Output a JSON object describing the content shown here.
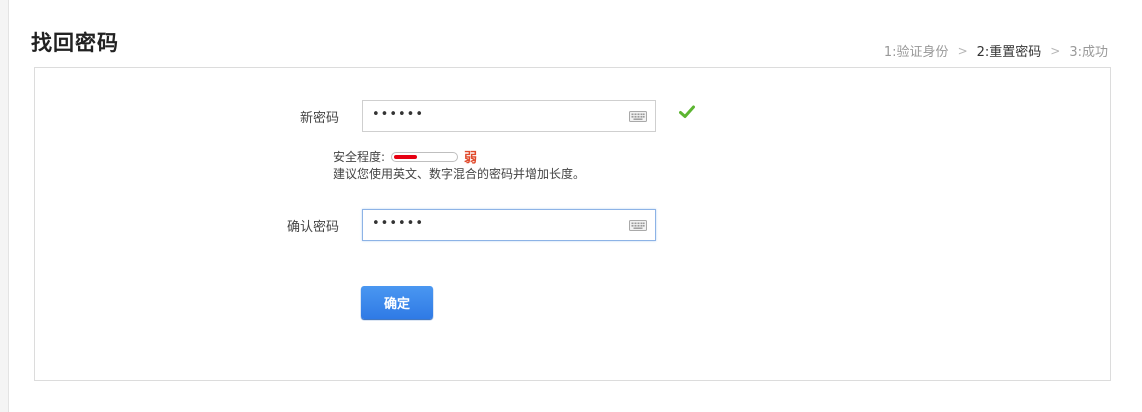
{
  "page": {
    "title": "找回密码"
  },
  "steps": [
    {
      "label": "1:验证身份",
      "active": false
    },
    {
      "label": "2:重置密码",
      "active": true
    },
    {
      "label": "3:成功",
      "active": false
    }
  ],
  "step_separator": ">",
  "form": {
    "new_password": {
      "label": "新密码",
      "value": "••••••",
      "status_icon": "check-icon"
    },
    "strength": {
      "label": "安全程度:",
      "level": "弱",
      "level_fraction": 0.35,
      "level_color": "#e04a2c"
    },
    "hint": "建议您使用英文、数字混合的密码并增加长度。",
    "confirm_password": {
      "label": "确认密码",
      "value": "••••••"
    },
    "submit_label": "确定"
  },
  "colors": {
    "accent": "#2f7ae5",
    "check": "#5cb531",
    "weak": "#e60012"
  }
}
